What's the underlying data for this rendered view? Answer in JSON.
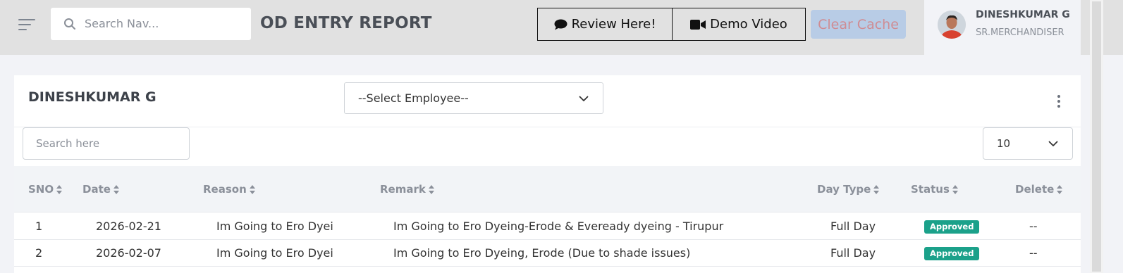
{
  "header": {
    "search_placeholder": "Search Nav...",
    "title": "OD ENTRY REPORT",
    "review_label": "Review Here!",
    "demo_label": "Demo Video",
    "clear_cache_label": "Clear Cache",
    "user": {
      "name": "DINESHKUMAR G",
      "role": "SR.MERCHANDISER"
    }
  },
  "card": {
    "title": "DINESHKUMAR G",
    "employee_select_value": "--Select Employee--",
    "search_placeholder": "Search here",
    "page_size": "10"
  },
  "table": {
    "columns": [
      "SNO",
      "Date",
      "Reason",
      "Remark",
      "Day Type",
      "Status",
      "Delete"
    ],
    "rows": [
      {
        "sno": "1",
        "date": "2026-02-21",
        "reason": "Im Going to Ero Dyei",
        "remark": "Im Going to Ero Dyeing-Erode & Eveready dyeing - Tirupur",
        "day_type": "Full Day",
        "status": "Approved",
        "delete": "--"
      },
      {
        "sno": "2",
        "date": "2026-02-07",
        "reason": "Im Going to Ero Dyei",
        "remark": "Im Going to Ero Dyeing, Erode (Due to shade issues)",
        "day_type": "Full Day",
        "status": "Approved",
        "delete": "--"
      }
    ]
  },
  "colors": {
    "topbar_bg": "#e1e1e1",
    "clear_cache_bg": "#b8cce6",
    "approved_badge": "#1ba18a",
    "header_text": "#8b909a"
  },
  "icons": {
    "menu": "hamburger-icon",
    "search": "search-icon",
    "review": "comment-icon",
    "demo": "video-camera-icon",
    "more": "kebab-menu-icon",
    "sort": "sort-icon",
    "dropdown": "chevron-down-icon"
  }
}
